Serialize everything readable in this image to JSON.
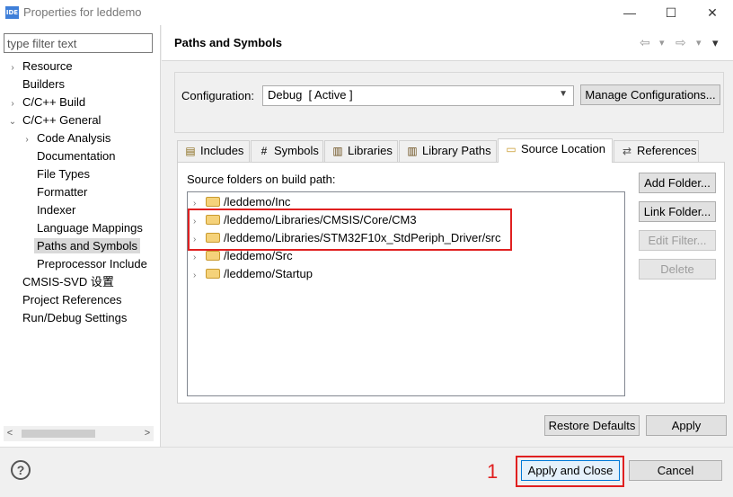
{
  "window": {
    "app_icon": "IDE",
    "title": "Properties for leddemo",
    "minimize_glyph": "—",
    "maximize_glyph": "☐",
    "close_glyph": "✕"
  },
  "sidebar": {
    "filter_placeholder": "type filter text",
    "items": [
      {
        "label": "Resource",
        "twisty": "›"
      },
      {
        "label": "Builders",
        "twisty": ""
      },
      {
        "label": "C/C++ Build",
        "twisty": "›"
      },
      {
        "label": "C/C++ General",
        "twisty": "⌄"
      },
      {
        "label": "Code Analysis",
        "twisty": "›"
      },
      {
        "label": "Documentation",
        "twisty": ""
      },
      {
        "label": "File Types",
        "twisty": ""
      },
      {
        "label": "Formatter",
        "twisty": ""
      },
      {
        "label": "Indexer",
        "twisty": ""
      },
      {
        "label": "Language Mappings",
        "twisty": ""
      },
      {
        "label": "Paths and Symbols",
        "twisty": ""
      },
      {
        "label": "Preprocessor Include",
        "twisty": ""
      },
      {
        "label": "CMSIS-SVD 设置",
        "twisty": ""
      },
      {
        "label": "Project References",
        "twisty": ""
      },
      {
        "label": "Run/Debug Settings",
        "twisty": ""
      }
    ],
    "selected": "Paths and Symbols",
    "scroll_left": "<",
    "scroll_right": ">"
  },
  "header": {
    "title": "Paths and Symbols",
    "nav_glyphs": [
      "⇦",
      "▾",
      "⇨",
      "▾",
      "▾"
    ]
  },
  "configuration": {
    "label": "Configuration:",
    "value": "Debug  [ Active ]",
    "manage_button": "Manage Configurations..."
  },
  "tabs": [
    {
      "label": "Includes",
      "icon": "includes-icon",
      "glyph": "▤"
    },
    {
      "label": "Symbols",
      "icon": "hash-icon",
      "glyph": "#"
    },
    {
      "label": "Libraries",
      "icon": "libraries-icon",
      "glyph": "▥"
    },
    {
      "label": "Library Paths",
      "icon": "library-paths-icon",
      "glyph": "▥"
    },
    {
      "label": "Source Location",
      "icon": "folder-icon",
      "glyph": "▭"
    },
    {
      "label": "References",
      "icon": "references-icon",
      "glyph": "⇄"
    }
  ],
  "active_tab": "Source Location",
  "source": {
    "label": "Source folders on build path:",
    "folders": [
      "/leddemo/Inc",
      "/leddemo/Libraries/CMSIS/Core/CM3",
      "/leddemo/Libraries/STM32F10x_StdPeriph_Driver/src",
      "/leddemo/Src",
      "/leddemo/Startup"
    ],
    "buttons": {
      "add_folder": "Add Folder...",
      "link_folder": "Link Folder...",
      "edit_filter": "Edit Filter...",
      "delete": "Delete"
    }
  },
  "footer": {
    "restore_defaults": "Restore Defaults",
    "apply": "Apply",
    "apply_and_close": "Apply and Close",
    "cancel": "Cancel",
    "help_glyph": "?",
    "annotation_number": "1"
  },
  "colors": {
    "highlight": "#e02020",
    "folder": "#f5d27a"
  }
}
